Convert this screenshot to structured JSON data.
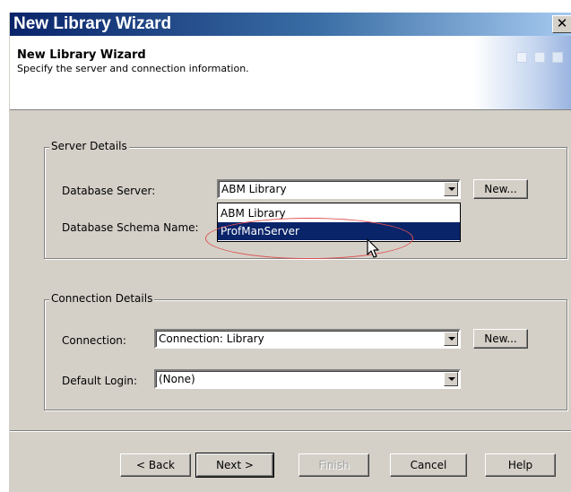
{
  "window": {
    "title": "New Library Wizard",
    "close_glyph": "✕"
  },
  "header": {
    "title": "New Library Wizard",
    "subtitle": "Specify the server and connection information."
  },
  "server_details": {
    "group_label": "Server Details",
    "database_server_label": "Database Server:",
    "database_server_value": "ABM Library",
    "database_schema_label": "Database Schema Name:",
    "new_button_label": "New...",
    "dropdown_options": [
      "ABM Library",
      "ProfManServer"
    ],
    "dropdown_selected": "ProfManServer"
  },
  "connection_details": {
    "group_label": "Connection Details",
    "connection_label": "Connection:",
    "connection_value": "Connection: Library",
    "default_login_label": "Default Login:",
    "default_login_value": "(None)",
    "new_button_label": "New..."
  },
  "footer": {
    "back_label": "< Back",
    "next_label": "Next >",
    "finish_label": "Finish",
    "cancel_label": "Cancel",
    "help_label": "Help"
  },
  "colors": {
    "titlebar_start": "#0a246a",
    "titlebar_end": "#a6caf0",
    "dialog_face": "#d4d0c8",
    "selection": "#0a246a",
    "annotation": "#e05050"
  },
  "icons": {
    "close": "close-icon",
    "dropdown_arrow": "chevron-down-icon",
    "cursor": "mouse-pointer-icon"
  }
}
